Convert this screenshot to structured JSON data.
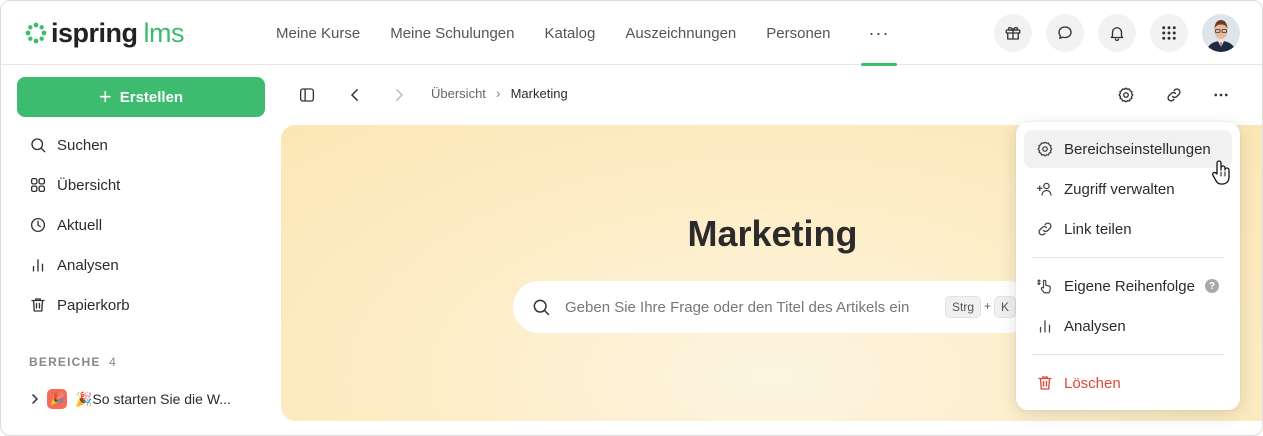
{
  "app": {
    "brand_main": "ispring",
    "brand_sub": "lms",
    "brand_color": "#3dbb6e"
  },
  "nav": {
    "items": [
      "Meine Kurse",
      "Meine Schulungen",
      "Katalog",
      "Auszeichnungen",
      "Personen"
    ],
    "more": "···"
  },
  "top_actions": [
    "gift-icon",
    "chat-icon",
    "bell-icon",
    "apps-grid-icon",
    "user-avatar"
  ],
  "sidebar": {
    "create_label": "Erstellen",
    "items": [
      {
        "label": "Suchen",
        "icon": "search-icon"
      },
      {
        "label": "Übersicht",
        "icon": "grid-icon"
      },
      {
        "label": "Aktuell",
        "icon": "clock-icon"
      },
      {
        "label": "Analysen",
        "icon": "bar-chart-icon"
      },
      {
        "label": "Papierkorb",
        "icon": "trash-icon"
      }
    ],
    "section_title": "BEREICHE",
    "section_count": "4",
    "tree": [
      {
        "emoji": "🎉",
        "label": "🎉So starten Sie die W..."
      }
    ]
  },
  "breadcrumb": {
    "items": [
      "Übersicht",
      "Marketing"
    ]
  },
  "hero": {
    "title": "Marketing",
    "search_placeholder": "Geben Sie Ihre Frage oder den Titel des Artikels ein",
    "shortcut_key1": "Strg",
    "shortcut_plus": "+",
    "shortcut_key2": "K"
  },
  "menu": {
    "items": [
      {
        "label": "Bereichseinstellungen",
        "icon": "gear-icon"
      },
      {
        "label": "Zugriff verwalten",
        "icon": "add-user-icon"
      },
      {
        "label": "Link teilen",
        "icon": "link-icon"
      },
      {
        "label": "Eigene Reihenfolge",
        "icon": "drag-hand-icon"
      },
      {
        "label": "Analysen",
        "icon": "bar-chart-icon"
      },
      {
        "label": "Löschen",
        "icon": "trash-icon"
      }
    ],
    "help_glyph": "?",
    "danger_color": "#e0463a"
  }
}
